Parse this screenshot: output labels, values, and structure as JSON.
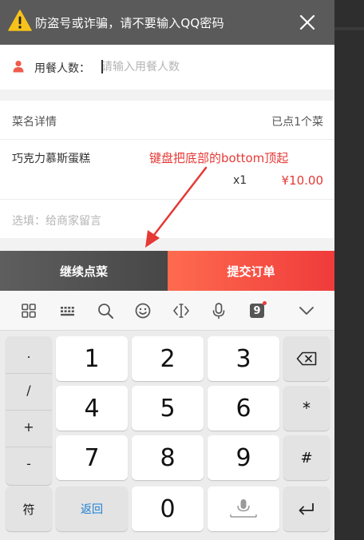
{
  "banner": {
    "text": "防盗号或诈骗，请不要输入QQ密码"
  },
  "diners": {
    "label": "用餐人数：",
    "placeholder": "请输入用餐人数"
  },
  "order": {
    "header_left": "菜名详情",
    "header_right": "已点1个菜",
    "items": [
      {
        "name": "巧克力慕斯蛋糕",
        "qty": "x1",
        "price": "¥10.00"
      }
    ],
    "note_placeholder": "选填：给商家留言"
  },
  "annotation": {
    "text": "键盘把底部的bottom顶起",
    "color": "#e53935"
  },
  "actions": {
    "continue_label": "继续点菜",
    "submit_label": "提交订单"
  },
  "keyboard": {
    "toolbar_icons": [
      "grid-icon",
      "keyboard-icon",
      "search-icon",
      "emoji-icon",
      "cursor-icon",
      "microphone-icon",
      "clipboard-icon",
      "chevron-down-icon"
    ],
    "toolbar_badge": "9",
    "symbols": [
      ".",
      "/",
      "+",
      "-"
    ],
    "keys": [
      "1",
      "2",
      "3",
      "4",
      "5",
      "6",
      "7",
      "8",
      "9",
      "0"
    ],
    "symbol_key": "符",
    "back_key": "返回",
    "asterisk_key": "*",
    "hash_key": "#"
  },
  "colors": {
    "accent_red": "#ef3b3b",
    "price_red": "#e53935",
    "banner_bg": "#5a5a5a"
  }
}
